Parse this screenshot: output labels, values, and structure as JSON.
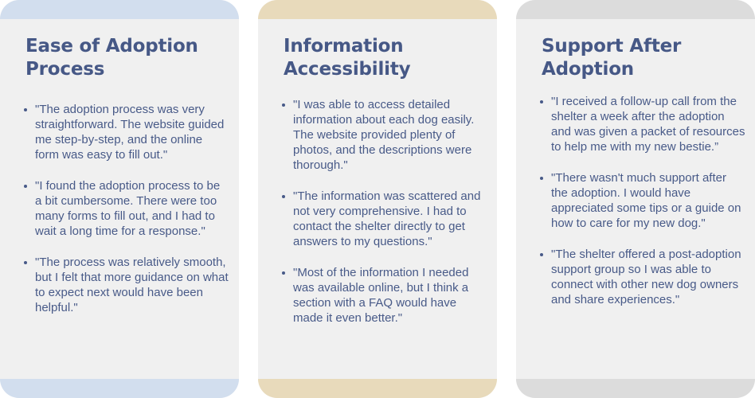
{
  "colors": {
    "card_background": "#f0f0f0",
    "heading_text": "#465886",
    "body_text": "#485a88"
  },
  "cards": [
    {
      "title": "Ease of Adoption Process",
      "accent": "#d2deee",
      "quotes": [
        "\"The adoption process was very straightforward. The website guided me step-by-step, and the online form was easy to fill out.\"",
        "\"I found the adoption process to be a bit cumbersome. There were too many forms to fill out, and I had to wait a long time for a response.\"",
        "\"The process was relatively smooth, but I felt that more guidance on what to expect next would have been helpful.\""
      ]
    },
    {
      "title": "Information Accessibility",
      "accent": "#e8dabb",
      "quotes": [
        "\"I was able to access detailed information about each dog easily. The website provided plenty of photos, and the descriptions were thorough.\"",
        "\"The information was scattered and not very comprehensive. I had to contact the shelter directly to get answers to my questions.\"",
        "\"Most of the information I needed was available online, but I think a section with a FAQ would have made it even better.\""
      ]
    },
    {
      "title": "Support After Adoption",
      "accent": "#dcdcdc",
      "quotes": [
        "\"I received a follow-up call from the shelter a week after the adoption and was given a packet of resources to help me with my new bestie.”",
        "\"There wasn't much support after the adoption. I would have appreciated some tips or a guide on how to care for my new dog.\"",
        "\"The shelter offered a post-adoption support group so I was able to connect with other new dog owners and share experiences.\""
      ]
    }
  ]
}
